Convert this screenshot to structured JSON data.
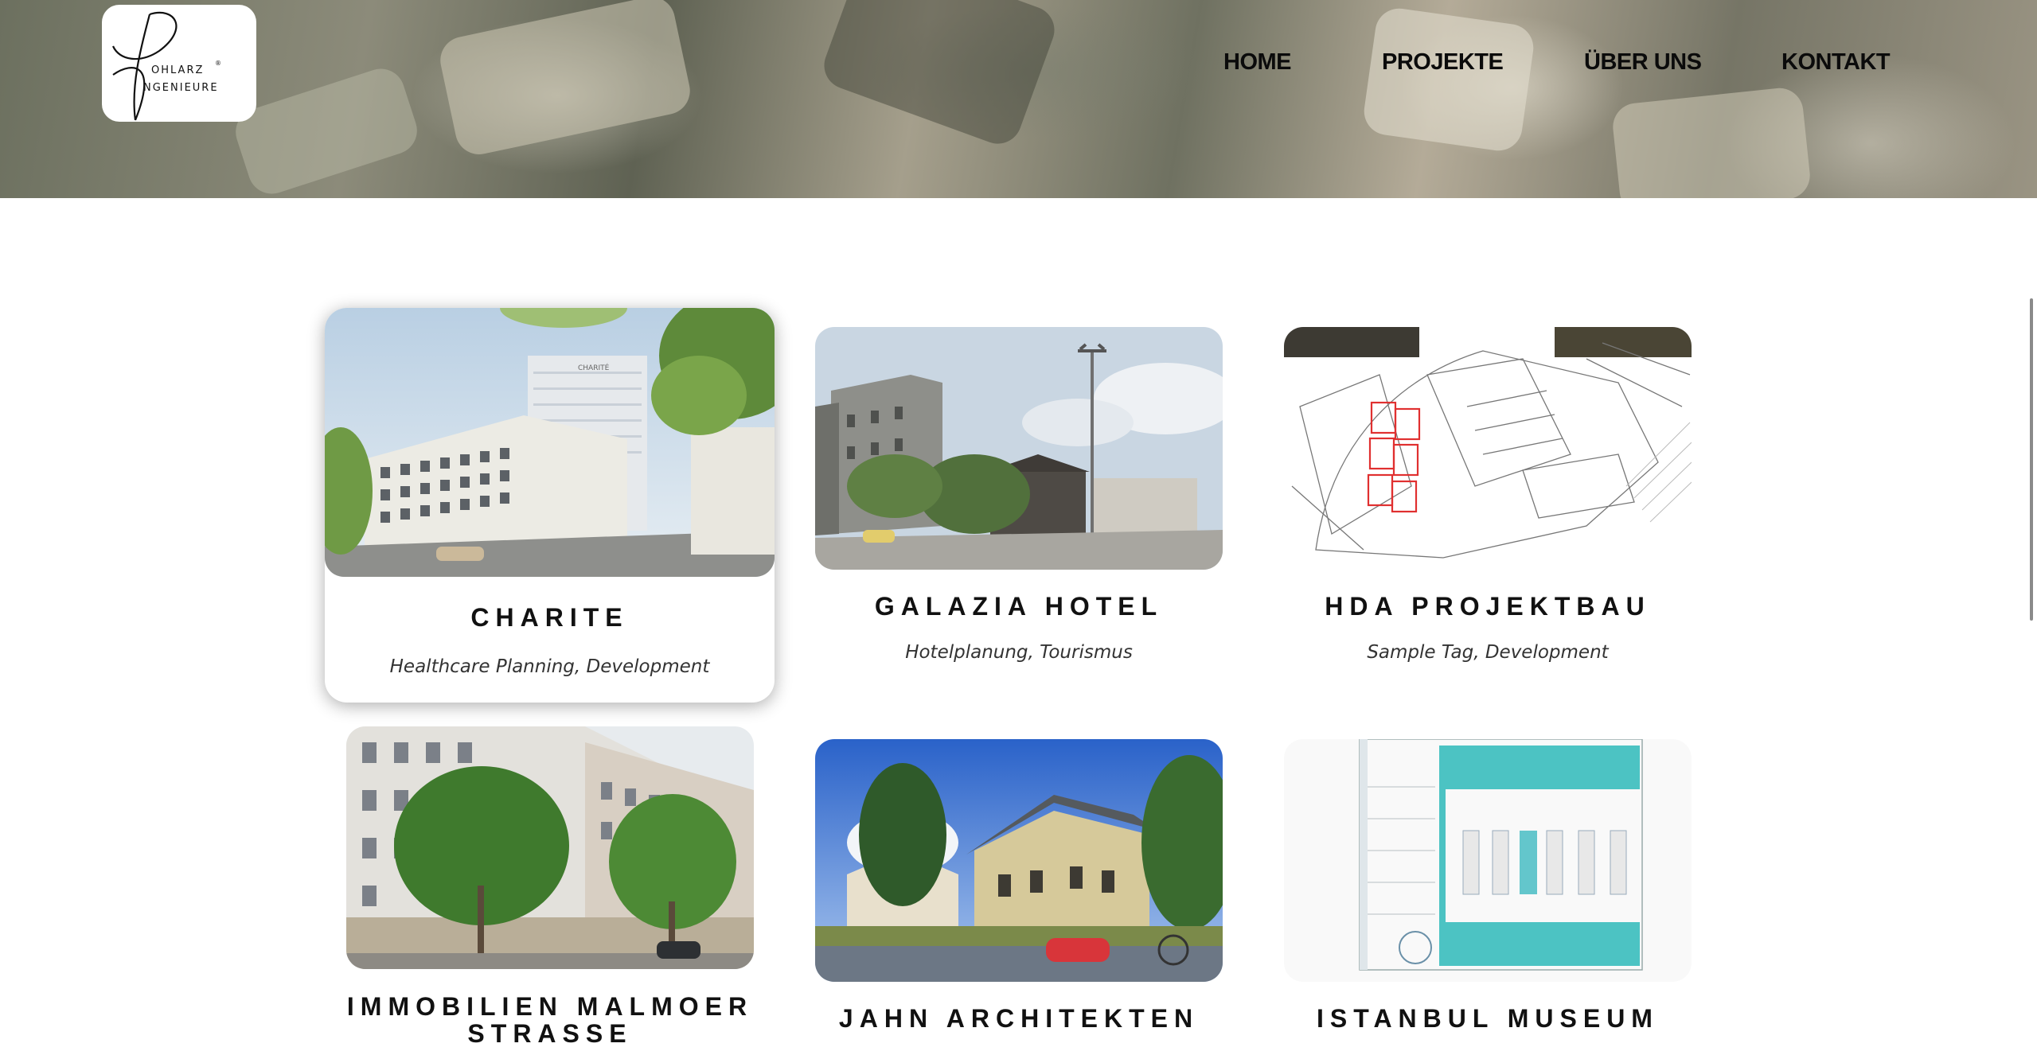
{
  "header": {
    "logo": {
      "text_top": "OHLARZ",
      "text_bottom": "NGENIEURE",
      "reg_mark": "®"
    },
    "nav": [
      {
        "label": "HOME"
      },
      {
        "label": "PROJEKTE"
      },
      {
        "label": "ÜBER UNS"
      },
      {
        "label": "KONTAKT"
      }
    ]
  },
  "projects": [
    {
      "title": "CHARITE",
      "tags": "Healthcare Planning, Development",
      "image": "charite-building-photo",
      "sign": "CHARITÉ",
      "hovered": true
    },
    {
      "title": "GALAZIA HOTEL",
      "tags": "Hotelplanung, Tourismus",
      "image": "street-panorama-photo"
    },
    {
      "title": "HDA PROJEKTBAU",
      "tags": "Sample Tag, Development",
      "image": "floor-plan-drawing"
    },
    {
      "title": "IMMOBILIEN MALMOER STRASSE",
      "tags": "",
      "image": "apartment-building-render"
    },
    {
      "title": "JAHN ARCHITEKTEN",
      "tags": "",
      "image": "villa-render"
    },
    {
      "title": "ISTANBUL MUSEUM",
      "tags": "",
      "image": "parking-floor-plan"
    }
  ],
  "colors": {
    "background": "#ffffff",
    "text": "#111111",
    "nav_text": "#0b0b0b",
    "plan_red": "#e03030",
    "plan_teal": "#4cc3c3"
  }
}
